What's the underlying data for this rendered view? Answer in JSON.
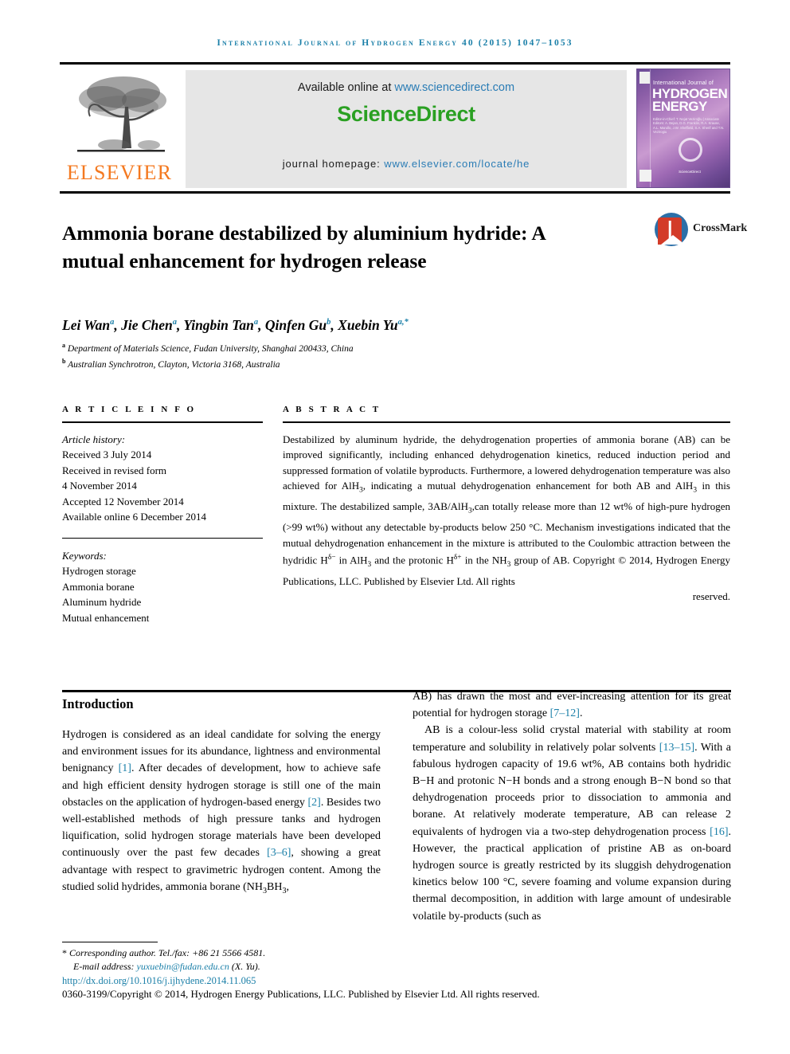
{
  "running_head": "International Journal of Hydrogen Energy 40 (2015) 1047–1053",
  "masthead": {
    "publisher_name": "ELSEVIER",
    "available_prefix": "Available online at ",
    "available_url": "www.sciencedirect.com",
    "sciencedirect_logo": "ScienceDirect",
    "homepage_prefix": "journal homepage: ",
    "homepage_url": "www.elsevier.com/locate/he",
    "cover": {
      "line1": "International Journal of",
      "line2": "HYDROGEN",
      "line3": "ENERGY",
      "editors": "Editor-in-Chief: T. Nejat Veziroğlu  |  Associate Editors: A. Bejan, D.G. Franklin, R.A. Krause, A.L. Marullo, J.W. Sheffield, S.A. Sherif and T.N. Vezirogiu",
      "footer_logo": "ScienceDirect"
    }
  },
  "article": {
    "title": "Ammonia borane destabilized by aluminium hydride: A mutual enhancement for hydrogen release",
    "crossmark_label": "CrossMark",
    "authors": [
      {
        "name": "Lei Wan",
        "sup": "a"
      },
      {
        "name": "Jie Chen",
        "sup": "a"
      },
      {
        "name": "Yingbin Tan",
        "sup": "a"
      },
      {
        "name": "Qinfen Gu",
        "sup": "b"
      },
      {
        "name": "Xuebin Yu",
        "sup": "a,*"
      }
    ],
    "affiliations": [
      {
        "marker": "a",
        "text": "Department of Materials Science, Fudan University, Shanghai 200433, China"
      },
      {
        "marker": "b",
        "text": "Australian Synchrotron, Clayton, Victoria 3168, Australia"
      }
    ]
  },
  "article_info": {
    "heading": "A R T I C L E   I N F O",
    "history_label": "Article history:",
    "history": [
      "Received 3 July 2014",
      "Received in revised form",
      "4 November 2014",
      "Accepted 12 November 2014",
      "Available online 6 December 2014"
    ],
    "keywords_label": "Keywords:",
    "keywords": [
      "Hydrogen storage",
      "Ammonia borane",
      "Aluminum hydride",
      "Mutual enhancement"
    ]
  },
  "abstract": {
    "heading": "A B S T R A C T",
    "paragraph_part1": "Destabilized by aluminum hydride, the dehydrogenation properties of ammonia borane (AB) can be improved significantly, including enhanced dehydrogenation kinetics, reduced induction period and suppressed formation of volatile byproducts. Furthermore, a lowered dehydrogenation temperature was also achieved for AlH",
    "sub_3a": "3",
    "paragraph_part2": ", indicating a mutual dehydrogenation enhancement for both AB and AlH",
    "sub_3b": "3",
    "paragraph_part3": " in this mixture. The destabilized sample, 3AB/AlH",
    "sub_3c": "3",
    "paragraph_part4": ",can totally release more than 12 wt% of high-pure hydrogen (>99 wt%) without any detectable by-products below 250 °C. Mechanism investigations indicated that the mutual dehydrogenation enhancement in the mixture is attributed to the Coulombic attraction between the hydridic H",
    "sup_dminus": "δ−",
    "paragraph_part5": " in AlH",
    "sub_3d": "3",
    "paragraph_part6": " and the protonic H",
    "sup_dplus": "δ+",
    "paragraph_part7": " in the NH",
    "sub_3e": "3",
    "paragraph_part8": " group of AB.",
    "copyright": "Copyright © 2014, Hydrogen Energy Publications, LLC. Published by Elsevier Ltd. All rights",
    "copyright_last": "reserved."
  },
  "introduction": {
    "heading": "Introduction",
    "left_p1_a": "Hydrogen is considered as an ideal candidate for solving the energy and environment issues for its abundance, lightness and environmental benignancy ",
    "left_ref1": "[1]",
    "left_p1_b": ". After decades of development, how to achieve safe and high efficient density hydrogen storage is still one of the main obstacles on the application of hydrogen-based energy ",
    "left_ref2": "[2]",
    "left_p1_c": ". Besides two well-established methods of high pressure tanks and hydrogen liquification, solid hydrogen storage materials have been developed continuously over the past few decades ",
    "left_ref3": "[3–6]",
    "left_p1_d": ", showing a great advantage with respect to gravimetric hydrogen content. Among the studied solid hydrides, ammonia borane (NH",
    "left_sub3a": "3",
    "left_p1_e": "BH",
    "left_sub3b": "3",
    "left_p1_f": ",",
    "right_p1_a": "AB) has drawn the most and ever-increasing attention for its great potential for hydrogen storage ",
    "right_ref7": "[7–12]",
    "right_p1_b": ".",
    "right_p2_a": "AB is a colour-less solid crystal material with stability at room temperature and solubility in relatively polar solvents ",
    "right_ref13": "[13–15]",
    "right_p2_b": ". With a fabulous hydrogen capacity of 19.6 wt%, AB contains both hydridic B−H and protonic N−H bonds and a strong enough B−N bond so that dehydrogenation proceeds prior to dissociation to ammonia and borane. At relatively moderate temperature, AB can release 2 equivalents of hydrogen via a two-step dehydrogenation process ",
    "right_ref16": "[16]",
    "right_p2_c": ". However, the practical application of pristine AB as on-board hydrogen source is greatly restricted by its sluggish dehydrogenation kinetics below 100 °C, severe foaming and volume expansion during thermal decomposition, in addition with large amount of undesirable volatile by-products (such as"
  },
  "footer": {
    "corresponding": "Corresponding author. Tel./fax: +86 21 5566 4581.",
    "email_label": "E-mail address: ",
    "email": "yuxuebin@fudan.edu.cn",
    "email_suffix": " (X. Yu).",
    "doi": "http://dx.doi.org/10.1016/j.ijhydene.2014.11.065",
    "copyright_line": "0360-3199/Copyright © 2014, Hydrogen Energy Publications, LLC. Published by Elsevier Ltd. All rights reserved."
  },
  "colors": {
    "accent_blue": "#1a7fa8",
    "link_blue": "#2a7cb5",
    "sciencedirect_green": "#2aa022",
    "elsevier_orange": "#f47920",
    "panel_gray": "#e6e6e6"
  }
}
